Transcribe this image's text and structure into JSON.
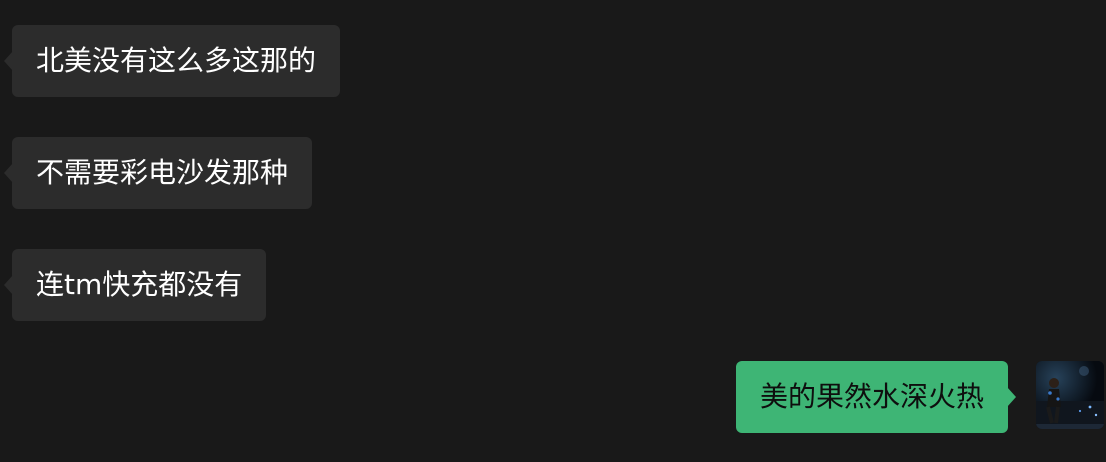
{
  "messages": [
    {
      "side": "received",
      "text": "北美没有这么多这那的"
    },
    {
      "side": "received",
      "text": "不需要彩电沙发那种"
    },
    {
      "side": "received",
      "text": "连tm快充都没有"
    },
    {
      "side": "sent",
      "text": "美的果然水深火热"
    }
  ],
  "colors": {
    "background": "#191919",
    "received_bubble": "#2c2c2c",
    "sent_bubble": "#3eb575"
  },
  "icons": {
    "user_avatar": "person-at-night-photo"
  }
}
